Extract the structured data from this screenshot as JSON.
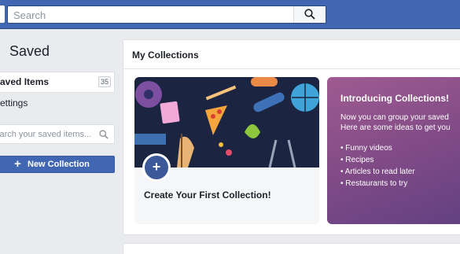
{
  "search": {
    "placeholder": "Search"
  },
  "sidebar": {
    "title": "Saved",
    "items": [
      {
        "label": "Saved Items",
        "count": "35"
      },
      {
        "label": "Settings"
      }
    ],
    "search_placeholder": "Search your saved items...",
    "new_collection_label": "New Collection"
  },
  "main": {
    "title": "My Collections",
    "create_label": "Create Your First Collection!",
    "intro": {
      "title": "Introducing Collections!",
      "body": [
        "Now you can group your saved",
        "Here are some ideas to get you"
      ],
      "ideas": [
        "Funny videos",
        "Recipes",
        "Articles to read later",
        "Restaurants to try"
      ]
    }
  },
  "colors": {
    "brand": "#4267b2",
    "collection_art_bg": "#1b2440",
    "intro_gradient": "#9f5b91"
  },
  "icons": [
    "search-icon",
    "plus-icon"
  ]
}
